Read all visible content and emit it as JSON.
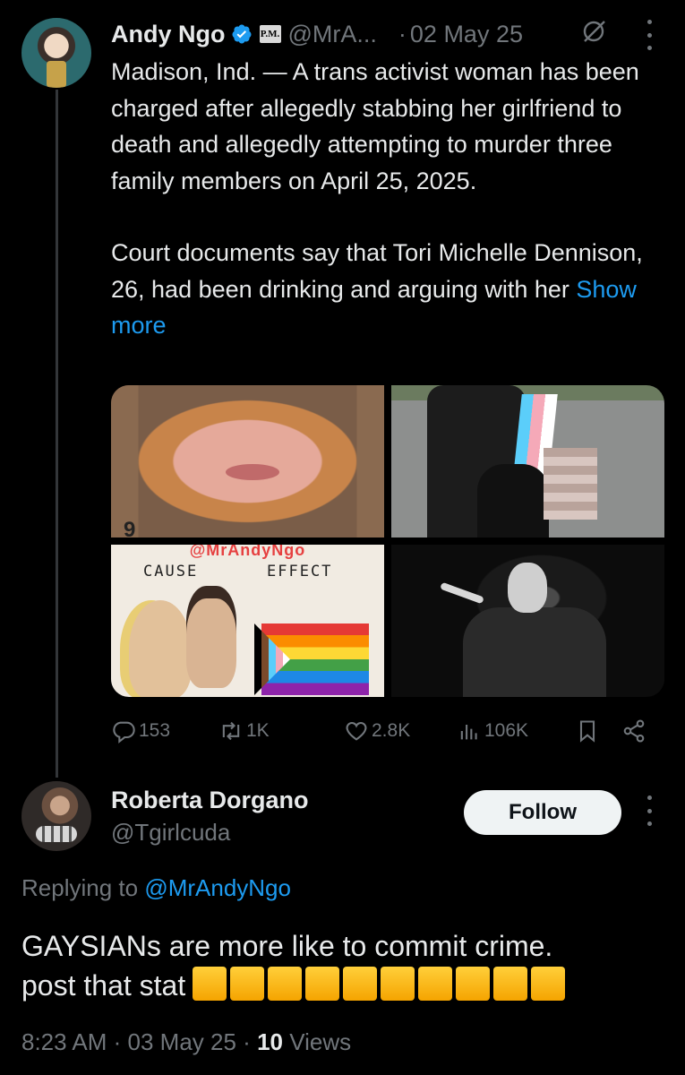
{
  "tweet": {
    "author_name": "Andy Ngo",
    "affiliate_badge": "P.M.",
    "handle": "@MrA...",
    "date": "02 May 25",
    "separator": "·",
    "paragraph1": "Madison, Ind. — A trans activist woman has been charged after allegedly stabbing her girlfriend to death and allegedly attempting to murder three family members on April 25, 2025.",
    "paragraph2_prefix": "Court documents say that Tori Michelle Dennison, 26, had been drinking and arguing with her ",
    "show_more": "Show more",
    "media": {
      "image3_watermark": "@MrAndyNgo",
      "image3_caption_left": "CAUSE",
      "image3_caption_right": "EFFECT",
      "image1_mark": "9"
    },
    "actions": {
      "replies": "153",
      "reposts": "1K",
      "likes": "2.8K",
      "views": "106K"
    }
  },
  "reply": {
    "author_name": "Roberta Dorgano",
    "handle": "@Tgirlcuda",
    "follow_label": "Follow",
    "replying_prefix": "Replying to ",
    "replying_to": "@MrAndyNgo",
    "text": "GAYSIANs are more like to commit crime. post that stat",
    "square_count": 10,
    "time": "8:23 AM",
    "date": "03 May 25",
    "views_count": "10",
    "views_label": "Views"
  },
  "colors": {
    "background": "#000000",
    "text": "#e7e9ea",
    "muted": "#71767b",
    "accent": "#1d9bf0",
    "verified": "#1d9bf0"
  },
  "icons": [
    "verified-icon",
    "grok-icon",
    "more-icon",
    "reply-icon",
    "repost-icon",
    "like-icon",
    "views-icon",
    "bookmark-icon",
    "share-icon"
  ]
}
